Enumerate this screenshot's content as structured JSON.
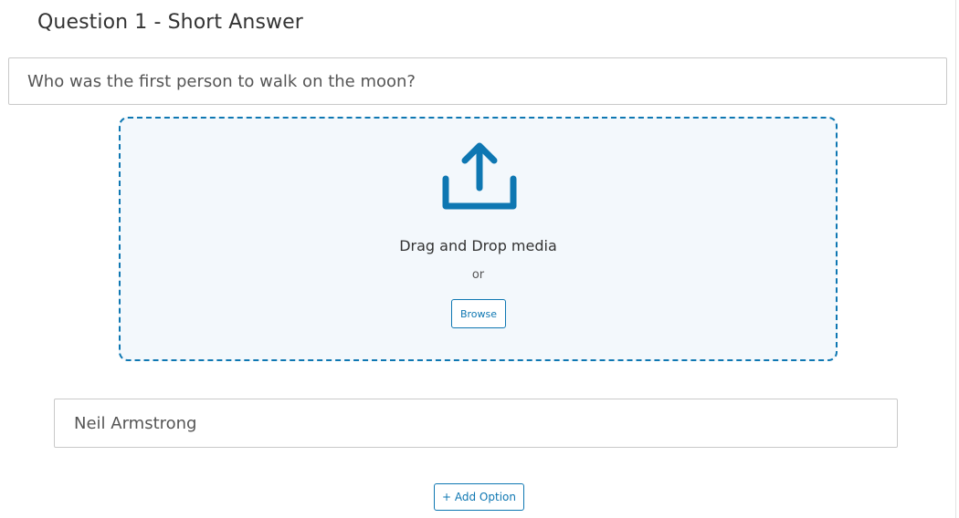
{
  "question": {
    "title": "Question 1 - Short Answer",
    "text": "Who was the first person to walk on the moon?"
  },
  "media": {
    "icon": "upload-icon",
    "drag_text": "Drag and Drop media",
    "or_text": "or",
    "browse_label": "Browse"
  },
  "answer": {
    "value": "Neil Armstrong"
  },
  "actions": {
    "add_option_label": "+ Add Option"
  },
  "colors": {
    "accent": "#0e77b2",
    "dropzone_bg": "#f3f8fc",
    "border": "#c9c9c9",
    "text": "#333333"
  }
}
